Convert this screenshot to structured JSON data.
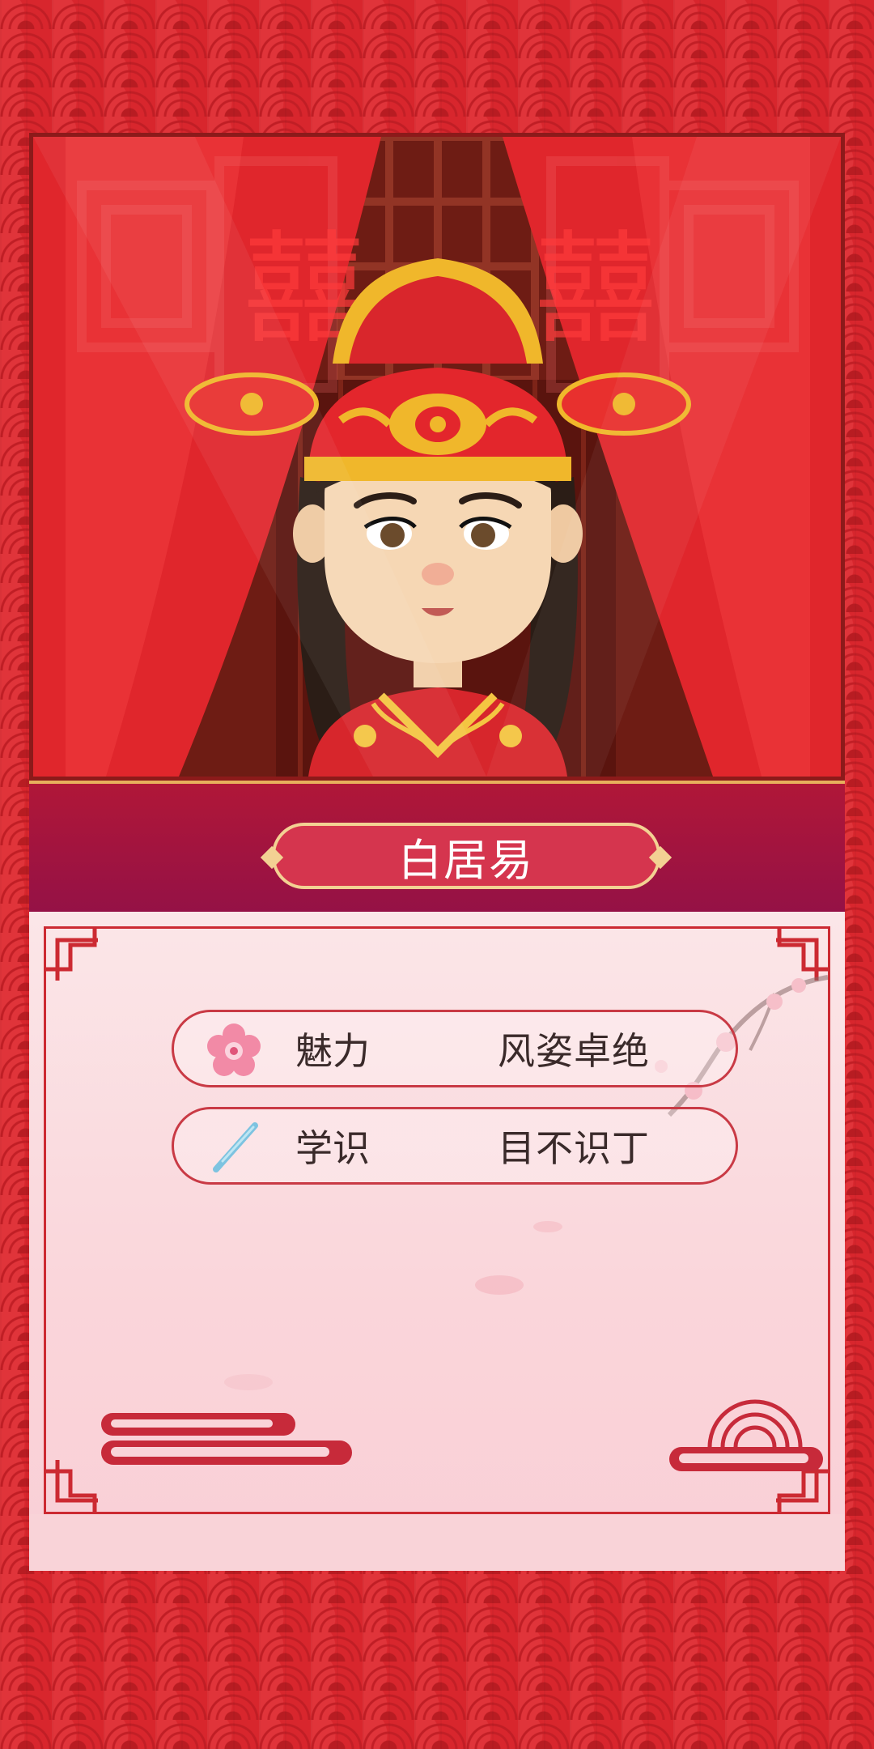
{
  "character": {
    "name": "白居易"
  },
  "stats": [
    {
      "icon": "plum-blossom-icon",
      "label": "魅力",
      "value": "风姿卓绝"
    },
    {
      "icon": "brush-icon",
      "label": "学识",
      "value": "目不识丁"
    }
  ],
  "colors": {
    "background": "#d8262d",
    "band": "#a3143f",
    "name_plate": "#d5354e",
    "panel": "#fbe2e6",
    "frame": "#cc2a32"
  }
}
